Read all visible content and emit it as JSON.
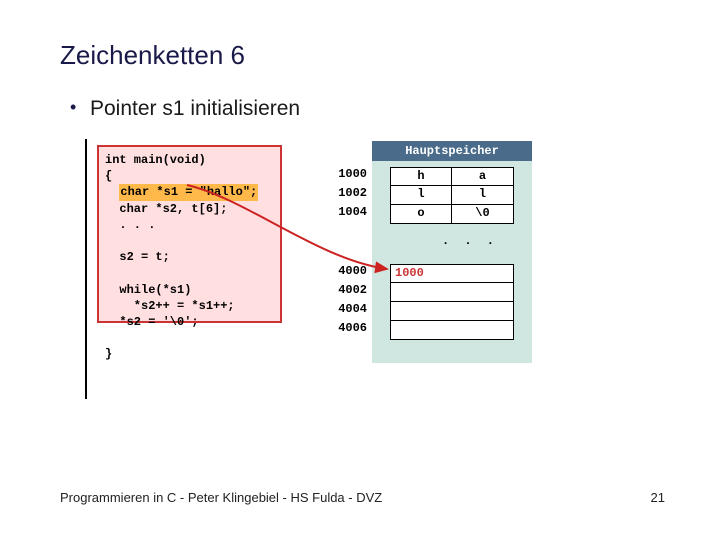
{
  "title": "Zeichenketten 6",
  "bullet": "Pointer s1 initialisieren",
  "code": {
    "l1": "int main(void)",
    "l2": "{",
    "l3a": "  ",
    "l3b": "char *s1 = \"hallo\";",
    "l4": "  char *s2, t[6];",
    "l5": "  . . .",
    "l6": "",
    "l7": "  s2 = t;",
    "l8": "",
    "l9": "  while(*s1)",
    "l10": "    *s2++ = *s1++;",
    "l11": "  *s2 = '\\0';",
    "l12": "",
    "l13": "}"
  },
  "memory": {
    "header": "Hauptspeicher",
    "addrs_top": [
      "1000",
      "1002",
      "1004"
    ],
    "rows_top": [
      [
        "h",
        "a"
      ],
      [
        "l",
        "l"
      ],
      [
        "o",
        "\\0"
      ]
    ],
    "dots": ". . .",
    "addrs_bot": [
      "4000",
      "4002",
      "4004",
      "4006"
    ],
    "val_bot": "1000"
  },
  "footer_left": "Programmieren in C - Peter Klingebiel - HS Fulda - DVZ",
  "footer_right": "21"
}
